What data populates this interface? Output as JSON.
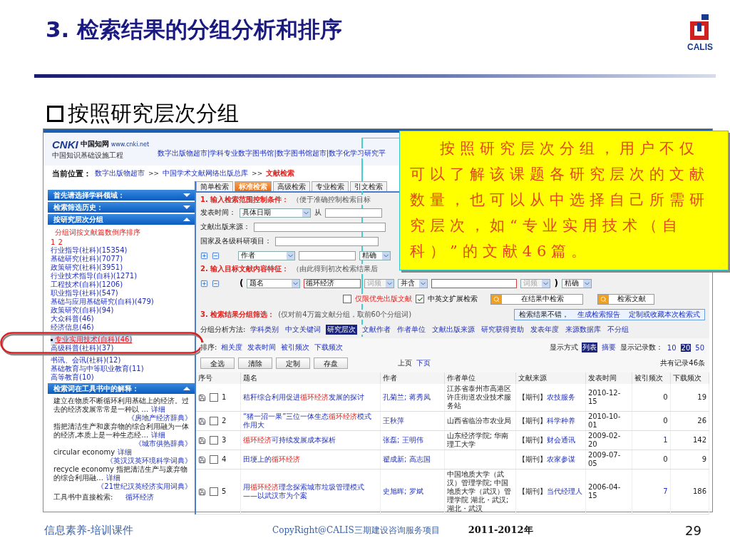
{
  "slide": {
    "title": "3. 检索结果的分组分析和排序",
    "logo": "CALIS",
    "subtitle": "按照研究层次分组"
  },
  "screenshot": {
    "brand": {
      "mark": "CNKI",
      "name": "中国知网",
      "url": "www.cnki.net",
      "tagline": "中国知识基础设施工程"
    },
    "nav": "数字出版物超市|学科专业数字图书馆|数字图书馆超市|数字化学习研究平",
    "breadcrumb": {
      "label": "当前位置：",
      "separator": ">>",
      "items": [
        "数字出版物超市",
        "中国学术文献网络出版总库",
        "文献检索"
      ]
    },
    "tabs": [
      {
        "label": "简单检索",
        "selected": false
      },
      {
        "label": "标准检索",
        "selected": true
      },
      {
        "label": "高级检索",
        "selected": false
      },
      {
        "label": "专业检索",
        "selected": false
      },
      {
        "label": "引文检索",
        "selected": false
      }
    ],
    "sidebar": {
      "panels": [
        {
          "title": "首先请选择学科领域：",
          "expanded": false
        },
        {
          "title": "检索筛选历史：",
          "expanded": false
        },
        {
          "title": "按研究层次分组",
          "expanded": true
        }
      ],
      "group_note": "分组词按文献篇数倒序排序",
      "pages": [
        "1",
        "2"
      ],
      "groups": [
        {
          "label": "行业指导(社科)(15354)",
          "selected": false
        },
        {
          "label": "基础研究(社科)(7077)",
          "selected": false
        },
        {
          "label": "政策研究(社科)(3951)",
          "selected": false
        },
        {
          "label": "行业技术指导(自科)(1271)",
          "selected": false
        },
        {
          "label": "工程技术(自科)(1206)",
          "selected": false
        },
        {
          "label": "职业指导(社科)(547)",
          "selected": false
        },
        {
          "label": "基础与应用基础研究(自科)(479)",
          "selected": false
        },
        {
          "label": "政策研究(自科)(94)",
          "selected": false
        },
        {
          "label": "大众科普(46)",
          "selected": false
        },
        {
          "label": "经济信息(46)",
          "selected": false
        },
        {
          "label": "专业实用技术(自科)(46)",
          "selected": true
        },
        {
          "label": "高级科普(社科)(37)",
          "selected": false
        },
        {
          "label": "书讯、会讯(社科)(12)",
          "selected": false
        },
        {
          "label": "基础教育与中等职业教育(11)",
          "selected": false
        },
        {
          "label": "高等教育(10)",
          "selected": false
        }
      ],
      "dictionary_panel": {
        "title": "检索词在工具书中的解释：",
        "expanded": true
      },
      "entries": [
        {
          "text": "建立在物质不断循环利用基础上的经济。过去的经济发展常常是一种以 …",
          "link": "详细",
          "source": "《房地产经济辞典》"
        },
        {
          "text": "指把清洁生产和废弃物的综合利用融为一体的经济,本质上是一种生态经…",
          "link": "详细",
          "source": "《城市供热辞典》"
        },
        {
          "text": "circular economy",
          "link": "详细",
          "source": "《英汉汉英环境科学词典》"
        },
        {
          "text": "recycle economy 指把清洁生产与废弃物的综合利用融…",
          "link": "详细",
          "source": "《21世纪汉英经济实用词典》"
        }
      ],
      "direct": {
        "label": "工具书中直接检索:",
        "link": "循环经济"
      }
    },
    "form": {
      "step1": {
        "label": "1. 输入检索范围控制条件：",
        "hint": "（便于准确控制检索目标"
      },
      "date": {
        "label": "发表时间：",
        "select": "具体日期",
        "from": "从"
      },
      "source": {
        "label": "文献出版来源："
      },
      "fund": {
        "label": "国家及各级科研项目："
      },
      "author": {
        "field": "作者",
        "match": "精确"
      },
      "step2": {
        "label": "2. 输入目标文献内容特征：",
        "hint": "（由此得到初次检索结果后"
      },
      "content": {
        "open": "(",
        "field": "题名",
        "value": "循环经济",
        "freq": {
          "label": "词频",
          "disabled": true
        },
        "logic": "并含",
        "freq2": {
          "label": "词频",
          "disabled": true
        },
        "close": ")",
        "match": "精确"
      },
      "options": [
        {
          "label": "仅限优先出版文献",
          "checked": false
        },
        {
          "label": "中英文扩展检索",
          "checked": true
        }
      ],
      "buttons": [
        "在结果中检索",
        "检索文献"
      ],
      "step3": {
        "label": "3. 检索结果分组筛选：",
        "hint": "(仅对前4万篇文献分组，取前60个分组词)"
      },
      "report": {
        "text": "检索结果不错，",
        "links": [
          "生成检索报告",
          "定制或收藏本次检索式"
        ]
      },
      "grouping": {
        "label": "分组分析方法:",
        "options": [
          {
            "label": "学科类别",
            "selected": false
          },
          {
            "label": "中文关键词",
            "selected": false
          },
          {
            "label": "研究层次",
            "selected": true
          },
          {
            "label": "文献作者",
            "selected": false
          },
          {
            "label": "作者单位",
            "selected": false
          },
          {
            "label": "文献出版来源",
            "selected": false
          },
          {
            "label": "研究获得资助",
            "selected": false
          },
          {
            "label": "发表年度",
            "selected": false
          },
          {
            "label": "来源数据库",
            "selected": false
          },
          {
            "label": "不分组",
            "selected": false
          }
        ]
      }
    },
    "sort": {
      "label": "排序:",
      "options": [
        "相关度",
        "发表时间",
        "被引频次",
        "下载频次"
      ]
    },
    "display": {
      "label": "显示方式",
      "modes": [
        {
          "label": "列表",
          "selected": true
        },
        {
          "label": "摘要",
          "selected": false
        }
      ],
      "count_label": "显示记录数：",
      "counts": [
        {
          "label": "10",
          "selected": false
        },
        {
          "label": "20",
          "selected": true
        },
        {
          "label": "50",
          "selected": false
        }
      ]
    },
    "toolbar": [
      "全选",
      "清除",
      "定制",
      "存盘"
    ],
    "pager": [
      "上页",
      "下页"
    ],
    "total": "共有记录46条",
    "table": {
      "columns": [
        "序号",
        "题名",
        "作者",
        "作者单位",
        "文献来源",
        "发表时间",
        "被引频次",
        "下载频次"
      ],
      "rows": [
        {
          "index": "1",
          "checked": false,
          "title": "秸秆综合利用促进**循环经济**发展的探讨",
          "authors": "孔菊兰; 蒋秀凤",
          "affiliation": "江苏省泰州市高港区许庄街道农业技术服务站",
          "source_type": "【期刊】",
          "source": "农技服务",
          "date": "2010-12-15",
          "cited": "0",
          "cited_linked": false,
          "downloads": "19"
        },
        {
          "index": "2",
          "checked": false,
          "title": "“猪一沼一果”三位一体生态**循环经济**模式作用大",
          "authors": "王秋萍",
          "affiliation": "山西省临汾市农业局",
          "source_type": "【期刊】",
          "source": "科学种养",
          "date": "2010-10-01",
          "cited": "0",
          "cited_linked": false,
          "downloads": "26"
        },
        {
          "index": "3",
          "checked": false,
          "title": "**循环经济**可持续发展成本探析",
          "authors": "张磊; 王明伟",
          "affiliation": "山东经济学院; 华南理工大学",
          "source_type": "【期刊】",
          "source": "财会通讯",
          "date": "2009-02-20",
          "cited": "1",
          "cited_linked": true,
          "downloads": "142"
        },
        {
          "index": "4",
          "checked": false,
          "title": "田埂上的**循环经济**",
          "authors": "翟成新; 高志国",
          "source_type": "【期刊】",
          "source": "农家参谋",
          "date": "2009-07-05",
          "cited": "0",
          "cited_linked": false,
          "downloads": "9"
        },
        {
          "index": "5",
          "checked": false,
          "title": "用**循环经济**理念探索城市垃圾管理模式——以武汉市为个案",
          "authors": "史旭晖; 罗斌",
          "affiliation": "中国地质大学（武汉）管理学院; 中国地质大学（武汉）管理学院 湖北・武汉; 湖北・武汉",
          "source_type": "【期刊】",
          "source": "当代经理人",
          "date": "2006-04-15",
          "cited": "7",
          "cited_linked": true,
          "downloads": "186"
        }
      ]
    }
  },
  "callout": "按照研究层次分组，用户不仅可以了解该课题各研究层次的文献数量，也可以从中选择自己所需研究层次，如“专业实用技术（自科）”的文献46篇。",
  "footer": {
    "course": "信息素养-培训课件",
    "copyright": "CopyRight@CALIS三期建设咨询服务项目",
    "years": "2011-2012年",
    "page": "29"
  }
}
